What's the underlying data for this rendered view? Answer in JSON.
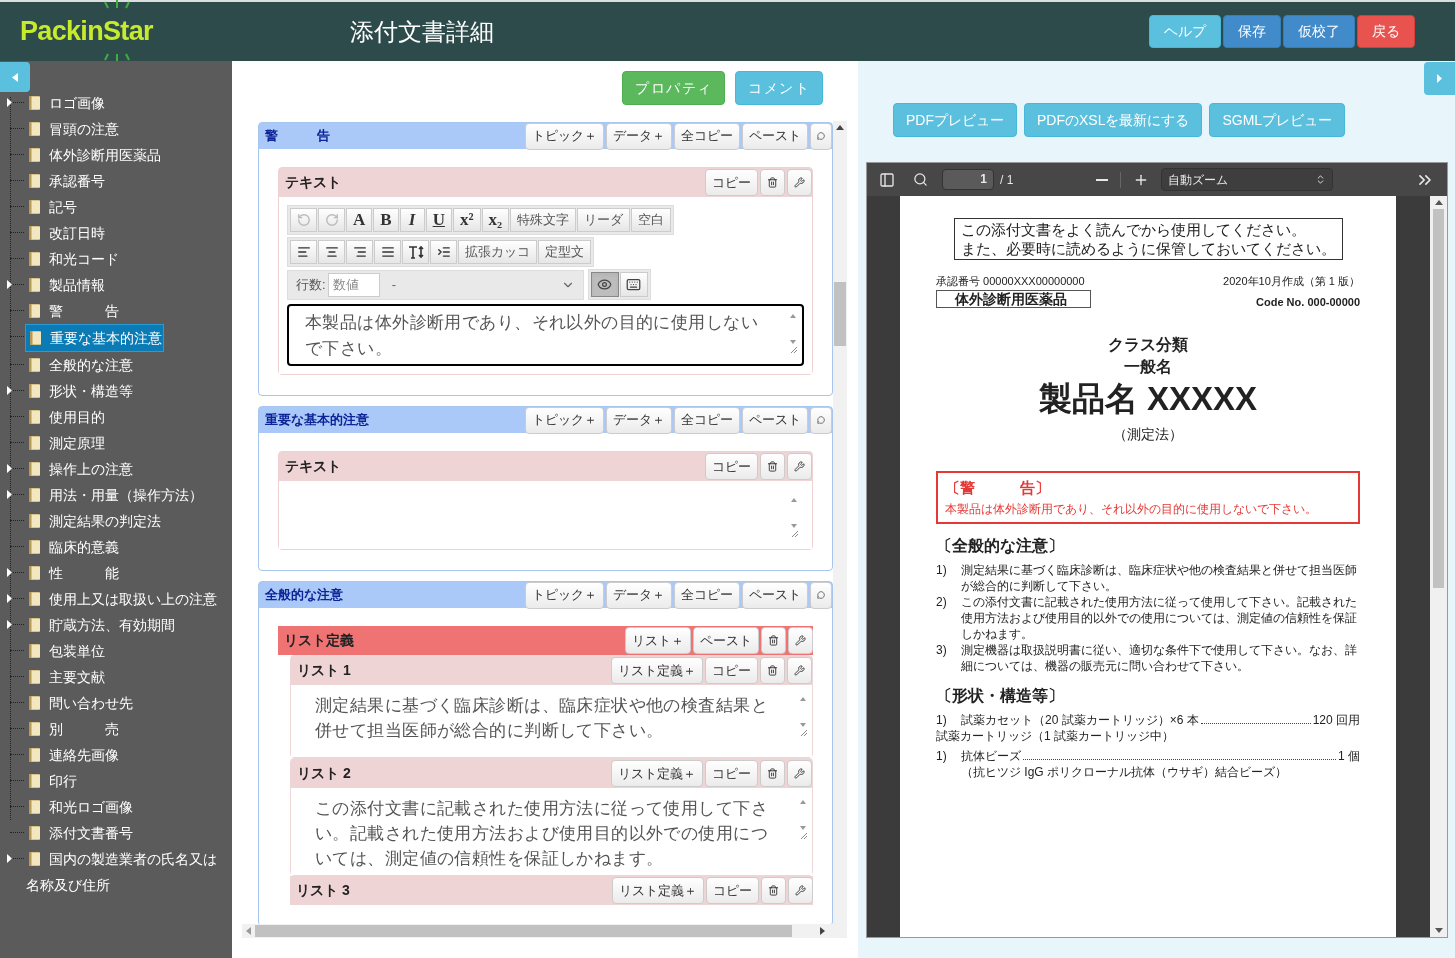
{
  "header": {
    "logo": "PackinStar",
    "title": "添付文書詳細",
    "buttons": [
      {
        "label": "ヘルプ",
        "kind": "info"
      },
      {
        "label": "保存",
        "kind": "primary"
      },
      {
        "label": "仮校了",
        "kind": "primary"
      },
      {
        "label": "戻る",
        "kind": "danger"
      }
    ]
  },
  "sidebar": {
    "items": [
      {
        "label": "ロゴ画像",
        "has_children": true,
        "selected": false
      },
      {
        "label": "冒頭の注意",
        "has_children": false,
        "selected": false
      },
      {
        "label": "体外診断用医薬品",
        "has_children": false,
        "selected": false
      },
      {
        "label": "承認番号",
        "has_children": false,
        "selected": false
      },
      {
        "label": "記号",
        "has_children": false,
        "selected": false
      },
      {
        "label": "改訂日時",
        "has_children": false,
        "selected": false
      },
      {
        "label": "和光コード",
        "has_children": false,
        "selected": false
      },
      {
        "label": "製品情報",
        "has_children": true,
        "selected": false
      },
      {
        "label": "警　　　告",
        "has_children": false,
        "selected": false
      },
      {
        "label": "重要な基本的注意",
        "has_children": false,
        "selected": true
      },
      {
        "label": "全般的な注意",
        "has_children": false,
        "selected": false
      },
      {
        "label": "形状・構造等",
        "has_children": true,
        "selected": false
      },
      {
        "label": "使用目的",
        "has_children": false,
        "selected": false
      },
      {
        "label": "測定原理",
        "has_children": false,
        "selected": false
      },
      {
        "label": "操作上の注意",
        "has_children": true,
        "selected": false
      },
      {
        "label": "用法・用量（操作方法）",
        "has_children": true,
        "selected": false
      },
      {
        "label": "測定結果の判定法",
        "has_children": false,
        "selected": false
      },
      {
        "label": "臨床的意義",
        "has_children": false,
        "selected": false
      },
      {
        "label": "性　　　能",
        "has_children": true,
        "selected": false
      },
      {
        "label": "使用上又は取扱い上の注意",
        "has_children": true,
        "selected": false
      },
      {
        "label": "貯蔵方法、有効期間",
        "has_children": true,
        "selected": false
      },
      {
        "label": "包装単位",
        "has_children": false,
        "selected": false
      },
      {
        "label": "主要文献",
        "has_children": false,
        "selected": false
      },
      {
        "label": "問い合わせ先",
        "has_children": false,
        "selected": false
      },
      {
        "label": "別　　　売",
        "has_children": false,
        "selected": false
      },
      {
        "label": "連絡先画像",
        "has_children": false,
        "selected": false
      },
      {
        "label": "印行",
        "has_children": false,
        "selected": false
      },
      {
        "label": "和光ロゴ画像",
        "has_children": false,
        "selected": false
      },
      {
        "label": "添付文書番号",
        "has_children": false,
        "selected": false
      },
      {
        "label": "国内の製造業者の氏名又は名称及び住所",
        "has_children": true,
        "selected": false
      }
    ]
  },
  "editor": {
    "buttons": [
      {
        "label": "プロパティ",
        "kind": "success"
      },
      {
        "label": "コメント",
        "kind": "info"
      }
    ],
    "sections": [
      {
        "title": "警　　　告",
        "actions": [
          "トピック＋",
          "データ＋",
          "全コピー",
          "ペースト"
        ],
        "blocks": [
          {
            "kind": "text",
            "label": "テキスト",
            "actions": [
              "コピー"
            ],
            "focused": true,
            "toolbar": {
              "edit_buttons": [
                {
                  "kind": "undo",
                  "disabled": true
                },
                {
                  "kind": "redo",
                  "disabled": true
                },
                {
                  "kind": "font",
                  "label": "A"
                },
                {
                  "kind": "bold",
                  "label": "B"
                },
                {
                  "kind": "italic",
                  "label": "I"
                },
                {
                  "kind": "underline",
                  "label": "U"
                },
                {
                  "kind": "font",
                  "label": "x²"
                },
                {
                  "kind": "font",
                  "label": "x₂"
                },
                {
                  "kind": "text",
                  "label": "特殊文字"
                },
                {
                  "kind": "text",
                  "label": "リーダ"
                },
                {
                  "kind": "text",
                  "label": "空白"
                }
              ],
              "paragraph_buttons": [
                {
                  "kind": "align-left"
                },
                {
                  "kind": "align-center"
                },
                {
                  "kind": "align-right"
                },
                {
                  "kind": "align-justify"
                },
                {
                  "kind": "line-height"
                },
                {
                  "kind": "indent"
                },
                {
                  "kind": "text",
                  "label": "拡張カッコ"
                },
                {
                  "kind": "text",
                  "label": "定型文"
                }
              ],
              "lines_label": "行数:",
              "lines_placeholder": "数値",
              "select_value": "-",
              "toggles": [
                {
                  "kind": "eye",
                  "selected": true
                },
                {
                  "kind": "keyboard",
                  "selected": false
                }
              ]
            },
            "value": "本製品は体外診断用であり、それ以外の目的に使用しないで下さい。"
          }
        ]
      },
      {
        "title": "重要な基本的注意",
        "actions": [
          "トピック＋",
          "データ＋",
          "全コピー",
          "ペースト"
        ],
        "blocks": [
          {
            "kind": "text",
            "label": "テキスト",
            "actions": [
              "コピー"
            ],
            "focused": false
          }
        ]
      },
      {
        "title": "全般的な注意",
        "actions": [
          "トピック＋",
          "データ＋",
          "全コピー",
          "ペースト"
        ],
        "blocks": [
          {
            "kind": "list",
            "label": "リスト定義",
            "actions": [
              "リスト＋",
              "ペースト"
            ],
            "items": [
              {
                "label": "リスト 1",
                "actions": [
                  "リスト定義＋",
                  "コピー"
                ],
                "value": "測定結果に基づく臨床診断は、臨床症状や他の検査結果と併せて担当医師が総合的に判断して下さい。"
              },
              {
                "label": "リスト 2",
                "actions": [
                  "リスト定義＋",
                  "コピー"
                ],
                "value": "この添付文書に記載された使用方法に従って使用して下さい。記載された使用方法および使用目的以外での使用については、測定値の信頼性を保証しかねます。"
              },
              {
                "label": "リスト 3",
                "actions": [
                  "リスト定義＋",
                  "コピー"
                ]
              }
            ]
          }
        ]
      }
    ]
  },
  "preview": {
    "buttons": [
      "PDFプレビュー",
      "PDFのXSLを最新にする",
      "SGMLプレビュー"
    ],
    "viewer": {
      "page": "1",
      "total": "/ 1",
      "zoom": "自動ズーム"
    },
    "document": {
      "notice": [
        "この添付文書をよく読んでから使用してください。",
        "また、必要時に読めるように保管しておいてください。"
      ],
      "approval": "承認番号 00000XXX00000000",
      "category": "体外診断用医薬品",
      "date": "2020年10月作成（第 1 版）",
      "code": "Code No. 000-00000",
      "class": "クラス分類",
      "generic_name": "一般名",
      "product_name": "製品名 XXXXX",
      "method": "（測定法）",
      "warning": {
        "title": "〔警　　　告〕",
        "text": "本製品は体外診断用であり、それ以外の目的に使用しないで下さい。"
      },
      "sections": [
        {
          "title": "〔全般的な注意〕",
          "items": [
            {
              "kind": "numbered",
              "number": "1)",
              "text": "測定結果に基づく臨床診断は、臨床症状や他の検査結果と併せて担当医師が総合的に判断して下さい。"
            },
            {
              "kind": "numbered",
              "number": "2)",
              "text": "この添付文書に記載された使用方法に従って使用して下さい。記載された使用方法および使用目的以外での使用については、測定値の信頼性を保証しかねます。"
            },
            {
              "kind": "numbered",
              "number": "3)",
              "text": "測定機器は取扱説明書に従い、適切な条件下で使用して下さい。なお、詳細については、機器の販売元に問い合わせて下さい。"
            }
          ]
        },
        {
          "title": "〔形状・構造等〕",
          "items": [
            {
              "kind": "leader",
              "number": "1)",
              "text": "試薬カセット（20 試薬カートリッジ）×6 本",
              "value": "120 回用"
            },
            {
              "kind": "heading",
              "text": "試薬カートリッジ（1 試薬カートリッジ中）"
            },
            {
              "kind": "leader",
              "number": "1)",
              "text": "抗体ビーズ",
              "value": "1 個",
              "note": "（抗ヒツジ IgG ポリクローナル抗体（ウサギ）結合ビーズ）"
            }
          ]
        }
      ]
    }
  }
}
